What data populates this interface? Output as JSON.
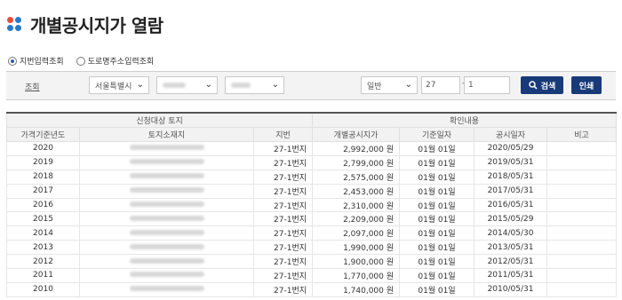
{
  "page": {
    "title": "개별공시지가 열람"
  },
  "radios": [
    {
      "label": "지번입력조회",
      "selected": true
    },
    {
      "label": "도로명주소입력조회",
      "selected": false
    }
  ],
  "search": {
    "label": "조회",
    "city": "서울특별시",
    "land_type": "일반",
    "bunji_main": "27",
    "bunji_sub": "1",
    "search_button": "검색",
    "print_button": "인쇄"
  },
  "table": {
    "group_headers": [
      "신청대상 토지",
      "확인내용"
    ],
    "columns": [
      "가격기준년도",
      "토지소재지",
      "지번",
      "개별공시지가",
      "기준일자",
      "공시일자",
      "비고"
    ],
    "rows": [
      {
        "year": "2020",
        "jibun": "27-1번지",
        "price": "2,992,000 원",
        "base_date": "01월 01일",
        "notice_date": "2020/05/29",
        "note": ""
      },
      {
        "year": "2019",
        "jibun": "27-1번지",
        "price": "2,799,000 원",
        "base_date": "01월 01일",
        "notice_date": "2019/05/31",
        "note": ""
      },
      {
        "year": "2018",
        "jibun": "27-1번지",
        "price": "2,575,000 원",
        "base_date": "01월 01일",
        "notice_date": "2018/05/31",
        "note": ""
      },
      {
        "year": "2017",
        "jibun": "27-1번지",
        "price": "2,453,000 원",
        "base_date": "01월 01일",
        "notice_date": "2017/05/31",
        "note": ""
      },
      {
        "year": "2016",
        "jibun": "27-1번지",
        "price": "2,310,000 원",
        "base_date": "01월 01일",
        "notice_date": "2016/05/31",
        "note": ""
      },
      {
        "year": "2015",
        "jibun": "27-1번지",
        "price": "2,209,000 원",
        "base_date": "01월 01일",
        "notice_date": "2015/05/29",
        "note": ""
      },
      {
        "year": "2014",
        "jibun": "27-1번지",
        "price": "2,097,000 원",
        "base_date": "01월 01일",
        "notice_date": "2014/05/30",
        "note": ""
      },
      {
        "year": "2013",
        "jibun": "27-1번지",
        "price": "1,990,000 원",
        "base_date": "01월 01일",
        "notice_date": "2013/05/31",
        "note": ""
      },
      {
        "year": "2012",
        "jibun": "27-1번지",
        "price": "1,900,000 원",
        "base_date": "01월 01일",
        "notice_date": "2012/05/31",
        "note": ""
      },
      {
        "year": "2011",
        "jibun": "27-1번지",
        "price": "1,770,000 원",
        "base_date": "01월 01일",
        "notice_date": "2011/05/31",
        "note": ""
      },
      {
        "year": "2010",
        "jibun": "27-1번지",
        "price": "1,740,000 원",
        "base_date": "01월 01일",
        "notice_date": "2010/05/31",
        "note": ""
      }
    ]
  },
  "colors": {
    "accent_button": "#183a78",
    "logo_red": "#e84b3c",
    "logo_blue": "#2a78c8"
  }
}
